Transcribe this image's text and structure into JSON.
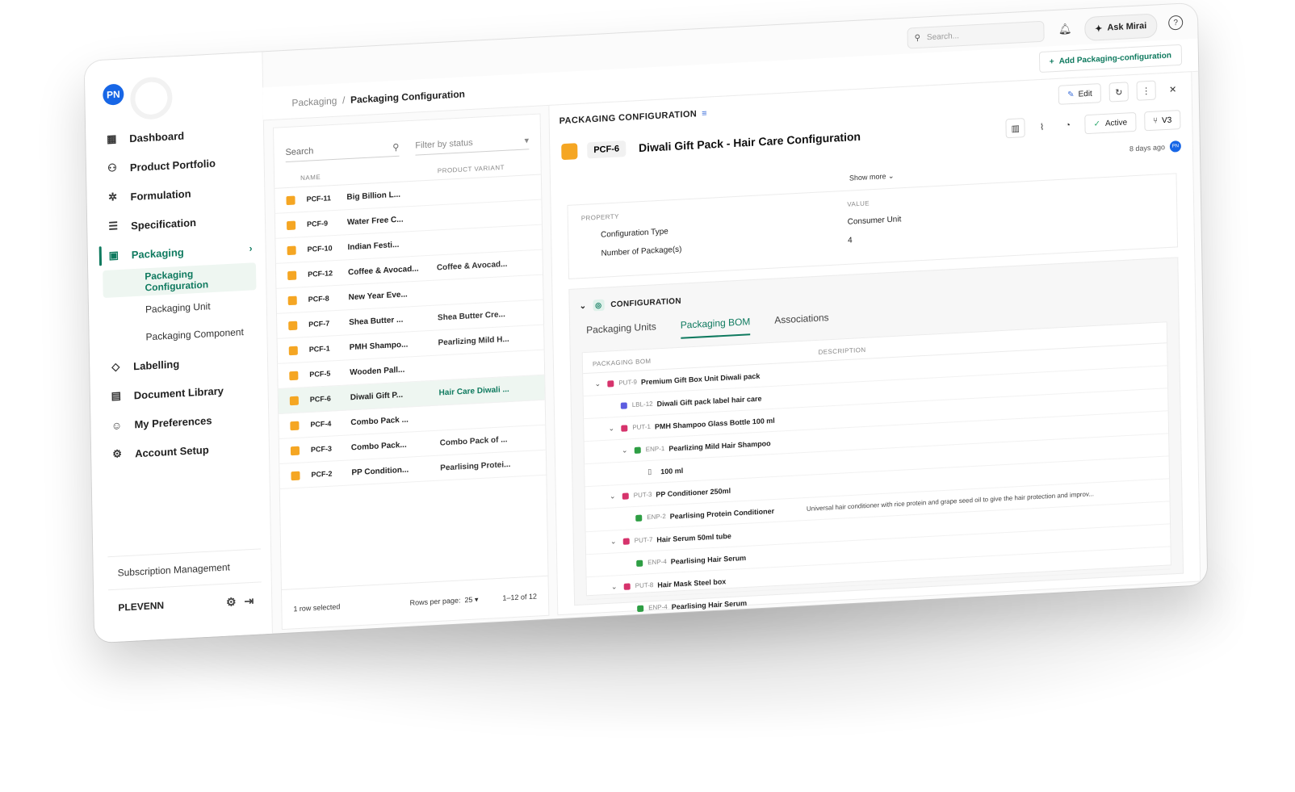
{
  "user": {
    "initials": "PN"
  },
  "topbar": {
    "search_placeholder": "Search...",
    "ask_label": "Ask Mirai"
  },
  "breadcrumb": {
    "parent": "Packaging",
    "separator": "/",
    "current": "Packaging Configuration"
  },
  "add_button_label": "Add Packaging-configuration",
  "sidebar": {
    "items": [
      {
        "label": "Dashboard",
        "icon": "dashboard-icon"
      },
      {
        "label": "Product Portfolio",
        "icon": "portfolio-icon"
      },
      {
        "label": "Formulation",
        "icon": "formulation-icon"
      },
      {
        "label": "Specification",
        "icon": "specification-icon"
      },
      {
        "label": "Packaging",
        "icon": "packaging-icon"
      },
      {
        "label": "Labelling",
        "icon": "tag-icon"
      },
      {
        "label": "Document Library",
        "icon": "library-icon"
      },
      {
        "label": "My Preferences",
        "icon": "preferences-icon"
      },
      {
        "label": "Account Setup",
        "icon": "account-icon"
      }
    ],
    "packaging_sub": [
      "Packaging Configuration",
      "Packaging Unit",
      "Packaging Component"
    ],
    "subscription_label": "Subscription Management",
    "org_name": "PLEVENN"
  },
  "list": {
    "search_placeholder": "Search",
    "filter_placeholder": "Filter by status",
    "col_name": "NAME",
    "col_variant": "PRODUCT VARIANT",
    "rows": [
      {
        "code": "PCF-11",
        "name": "Big Billion L...",
        "variant": ""
      },
      {
        "code": "PCF-9",
        "name": "Water Free C...",
        "variant": ""
      },
      {
        "code": "PCF-10",
        "name": "Indian Festi...",
        "variant": ""
      },
      {
        "code": "PCF-12",
        "name": "Coffee & Avocad...",
        "variant": "Coffee & Avocad..."
      },
      {
        "code": "PCF-8",
        "name": "New Year Eve...",
        "variant": ""
      },
      {
        "code": "PCF-7",
        "name": "Shea Butter ...",
        "variant": "Shea Butter Cre..."
      },
      {
        "code": "PCF-1",
        "name": "PMH Shampo...",
        "variant": "Pearlizing Mild H..."
      },
      {
        "code": "PCF-5",
        "name": "Wooden Pall...",
        "variant": ""
      },
      {
        "code": "PCF-6",
        "name": "Diwali Gift P...",
        "variant": "Hair Care Diwali ..."
      },
      {
        "code": "PCF-4",
        "name": "Combo Pack ...",
        "variant": ""
      },
      {
        "code": "PCF-3",
        "name": "Combo Pack...",
        "variant": "Combo Pack of ..."
      },
      {
        "code": "PCF-2",
        "name": "PP Condition...",
        "variant": "Pearlising Protei..."
      }
    ],
    "selected_text": "1 row selected",
    "rows_per_page_label": "Rows per page:",
    "rows_per_page": "25",
    "range": "1–12 of 12"
  },
  "detail": {
    "heading": "PACKAGING CONFIGURATION",
    "edit_label": "Edit",
    "code": "PCF-6",
    "name": "Diwali Gift Pack - Hair Care Configuration",
    "status": "Active",
    "version": "V3",
    "updated": "8 days ago",
    "updated_by": "PN",
    "show_more": "Show more",
    "col_property": "PROPERTY",
    "col_value": "VALUE",
    "properties": [
      {
        "label": "Configuration Type",
        "value": "Consumer Unit"
      },
      {
        "label": "Number of Package(s)",
        "value": "4"
      }
    ],
    "configuration_heading": "CONFIGURATION",
    "tabs": [
      "Packaging Units",
      "Packaging BOM",
      "Associations"
    ],
    "bom_col_name": "PACKAGING BOM",
    "bom_col_desc": "DESCRIPTION",
    "bom": [
      {
        "level": 0,
        "chev": true,
        "type": "put",
        "code": "PUT-9",
        "name": "Premium Gift Box Unit Diwali pack",
        "desc": ""
      },
      {
        "level": 1,
        "chev": false,
        "type": "lbl",
        "code": "LBL-12",
        "name": "Diwali Gift pack label hair care",
        "desc": ""
      },
      {
        "level": 1,
        "chev": true,
        "type": "put",
        "code": "PUT-1",
        "name": "PMH Shampoo Glass Bottle 100 ml",
        "desc": ""
      },
      {
        "level": 2,
        "chev": true,
        "type": "enp",
        "code": "ENP-1",
        "name": "Pearlizing Mild Hair Shampoo",
        "desc": ""
      },
      {
        "level": 3,
        "chev": false,
        "type": "none",
        "code": "",
        "name": "100 ml",
        "desc": ""
      },
      {
        "level": 1,
        "chev": true,
        "type": "put",
        "code": "PUT-3",
        "name": "PP Conditioner 250ml",
        "desc": ""
      },
      {
        "level": 2,
        "chev": false,
        "type": "enp",
        "code": "ENP-2",
        "name": "Pearlising Protein Conditioner",
        "desc": "Universal hair conditioner with rice protein and grape seed oil to give the hair protection and improv..."
      },
      {
        "level": 1,
        "chev": true,
        "type": "put",
        "code": "PUT-7",
        "name": "Hair Serum 50ml tube",
        "desc": ""
      },
      {
        "level": 2,
        "chev": false,
        "type": "enp",
        "code": "ENP-4",
        "name": "Pearlising Hair Serum",
        "desc": ""
      },
      {
        "level": 1,
        "chev": true,
        "type": "put",
        "code": "PUT-8",
        "name": "Hair Mask Steel box",
        "desc": ""
      },
      {
        "level": 2,
        "chev": false,
        "type": "enp",
        "code": "ENP-4",
        "name": "Pearlising Hair Serum",
        "desc": ""
      }
    ]
  }
}
